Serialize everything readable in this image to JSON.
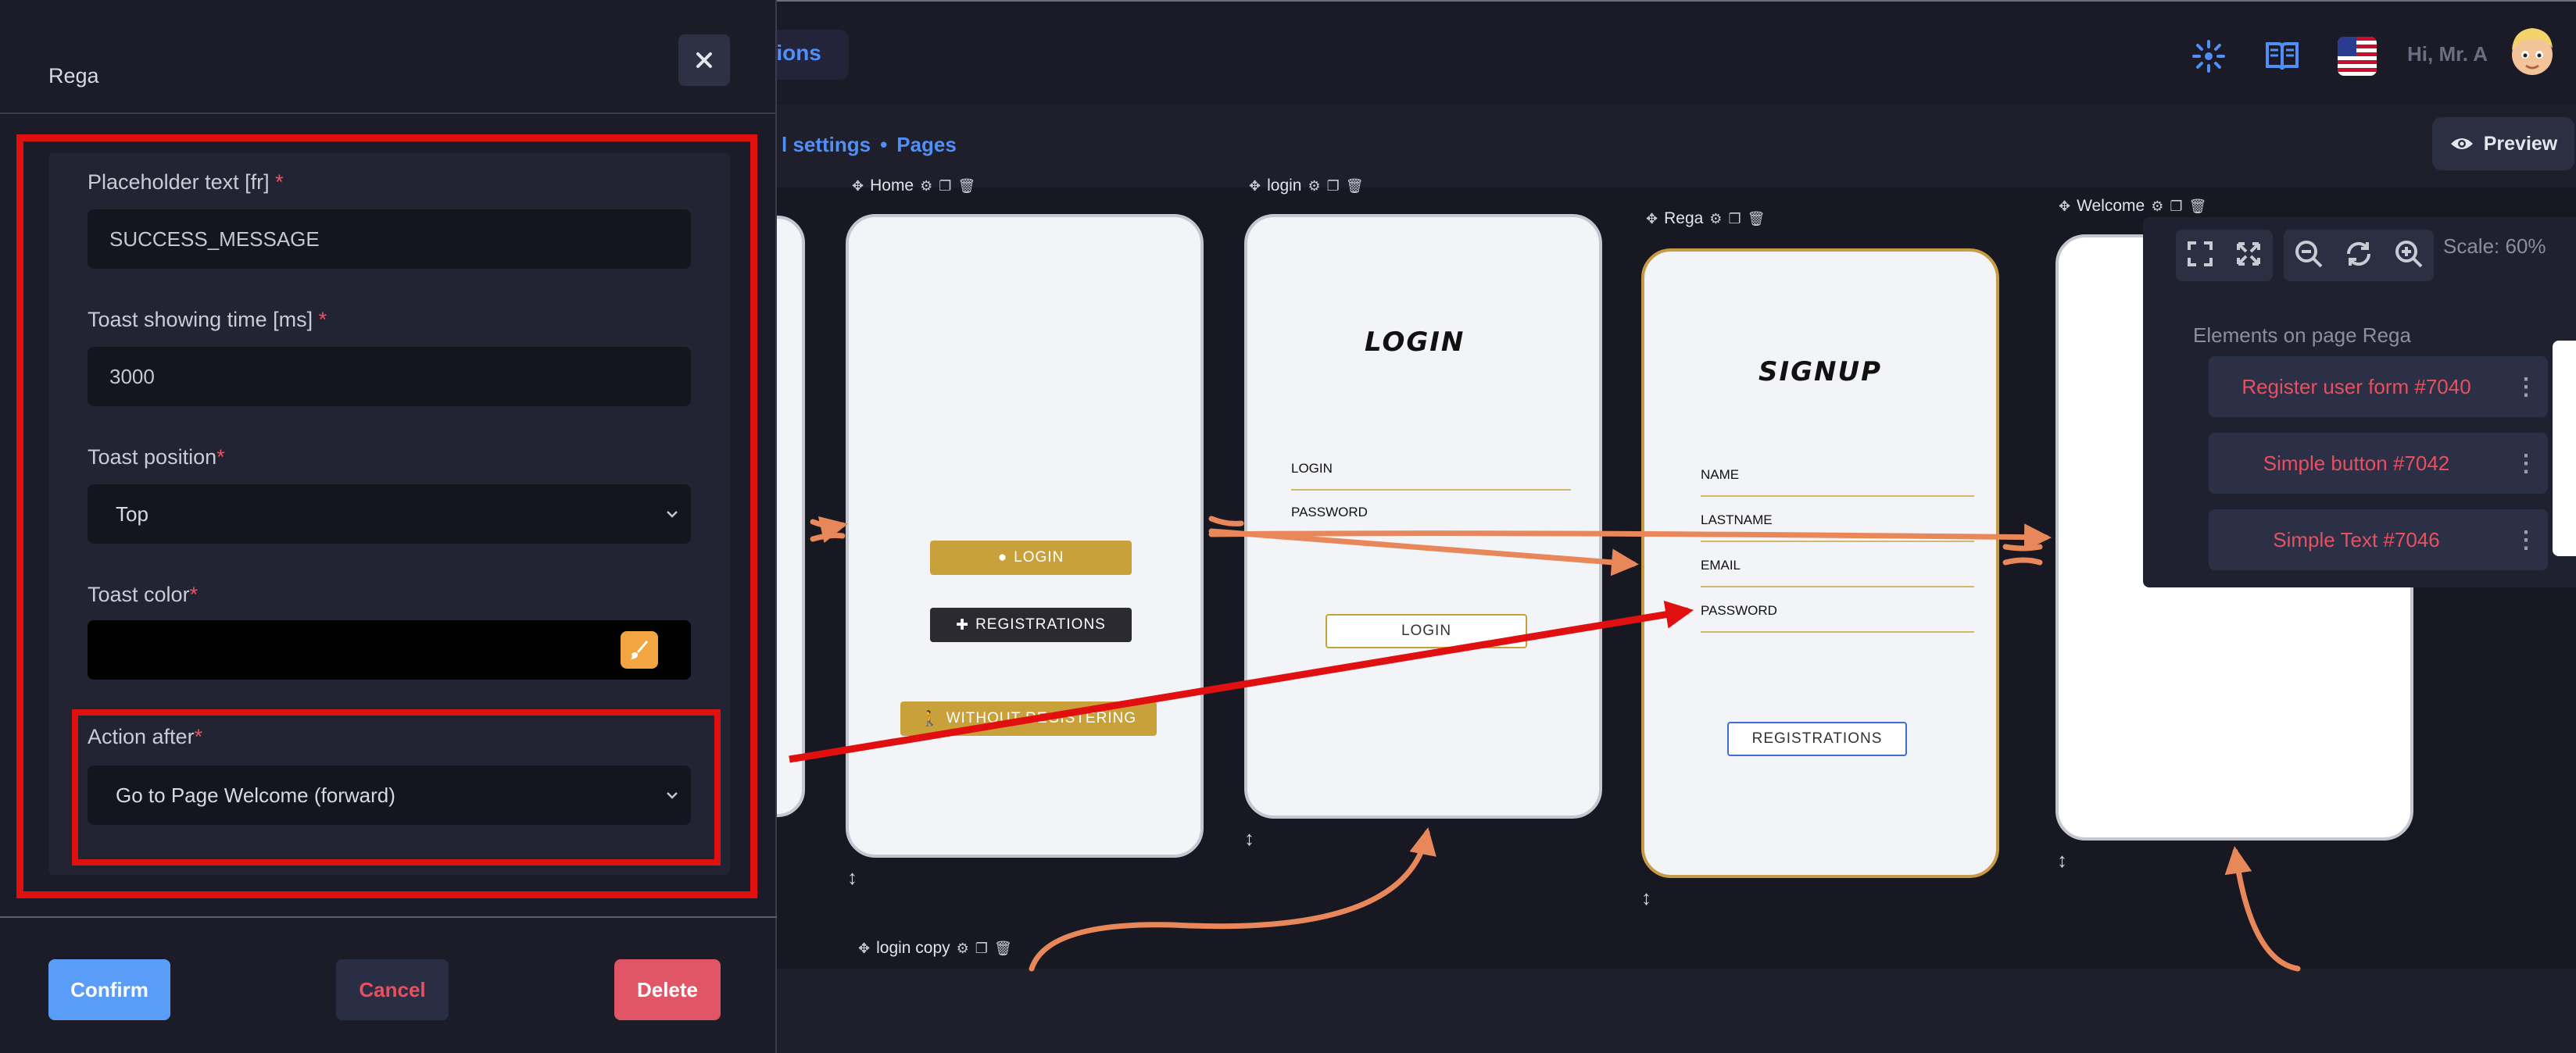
{
  "topbar": {
    "nav_fragment": "tions",
    "greeting": "Hi, Mr. A",
    "icons": [
      "spinner-icon",
      "book-icon",
      "us-flag-icon"
    ]
  },
  "subbar": {
    "crumb_settings": "l settings",
    "crumb_sep": "•",
    "crumb_pages": "Pages",
    "preview_label": "Preview"
  },
  "canvas": {
    "pages": [
      {
        "label": "Home"
      },
      {
        "label": "login"
      },
      {
        "label": "Rega"
      },
      {
        "label": "Welcome"
      },
      {
        "label": "login copy"
      }
    ],
    "home": {
      "btn_login": "LOGIN",
      "btn_registrations": "REGISTRATIONS",
      "btn_without": "WITHOUT REGISTERING"
    },
    "login": {
      "title": "LOGIN",
      "field_login": "LOGIN",
      "field_password": "PASSWORD",
      "btn_login": "LOGIN"
    },
    "rega": {
      "title": "SIGNUP",
      "field_name": "NAME",
      "field_lastname": "LASTNAME",
      "field_email": "EMAIL",
      "field_password": "PASSWORD",
      "btn_registrations": "REGISTRATIONS"
    }
  },
  "side_panel": {
    "scale": "Scale: 60%",
    "elements_title": "Elements on page Rega",
    "elements": [
      {
        "label": "Register user form #7040"
      },
      {
        "label": "Simple button #7042"
      },
      {
        "label": "Simple Text #7046"
      }
    ]
  },
  "modal": {
    "title": "Rega",
    "fields": {
      "placeholder_label": "Placeholder text [fr] ",
      "placeholder_value": "SUCCESS_MESSAGE",
      "time_label": "Toast showing time [ms] ",
      "time_value": "3000",
      "position_label": "Toast position",
      "position_value": "Top",
      "color_label": "Toast color",
      "color_value": "#000000",
      "action_label": "Action after",
      "action_value": "Go to Page Welcome (forward)",
      "required_mark": "*"
    },
    "buttons": {
      "confirm": "Confirm",
      "cancel": "Cancel",
      "delete": "Delete"
    }
  },
  "colors": {
    "accent_blue": "#4f8ff7",
    "danger": "#e05666",
    "highlight_red": "#e01010",
    "flow_arrow": "#e8875a",
    "selected_page": "#c79a45"
  }
}
